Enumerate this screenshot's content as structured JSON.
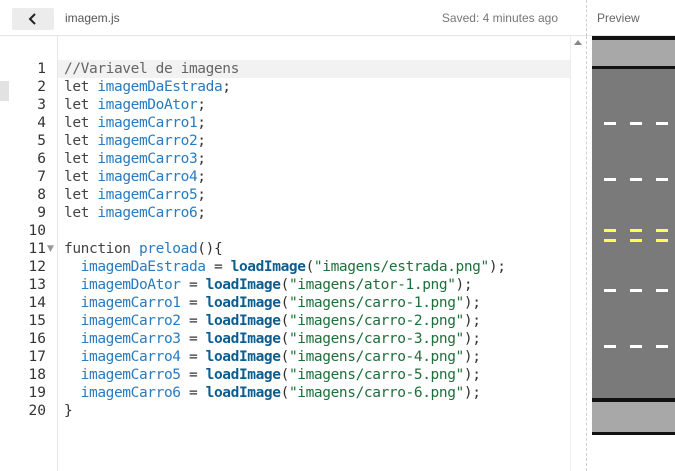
{
  "topbar": {
    "back_icon": "chevron-left-icon",
    "filename": "imagem.js",
    "saved_status": "Saved: 4 minutes ago",
    "preview_label": "Preview"
  },
  "editor": {
    "lines": [
      {
        "num": "1",
        "tokens": [
          {
            "t": "//Variavel de imagens",
            "c": "comment"
          }
        ]
      },
      {
        "num": "2",
        "tokens": [
          {
            "t": "let ",
            "c": "kw"
          },
          {
            "t": "imagemDaEstrada",
            "c": "var"
          },
          {
            "t": ";",
            "c": "punc"
          }
        ]
      },
      {
        "num": "3",
        "tokens": [
          {
            "t": "let ",
            "c": "kw"
          },
          {
            "t": "imagemDoAtor",
            "c": "var"
          },
          {
            "t": ";",
            "c": "punc"
          }
        ]
      },
      {
        "num": "4",
        "tokens": [
          {
            "t": "let ",
            "c": "kw"
          },
          {
            "t": "imagemCarro1",
            "c": "var"
          },
          {
            "t": ";",
            "c": "punc"
          }
        ]
      },
      {
        "num": "5",
        "tokens": [
          {
            "t": "let ",
            "c": "kw"
          },
          {
            "t": "imagemCarro2",
            "c": "var"
          },
          {
            "t": ";",
            "c": "punc"
          }
        ]
      },
      {
        "num": "6",
        "tokens": [
          {
            "t": "let ",
            "c": "kw"
          },
          {
            "t": "imagemCarro3",
            "c": "var"
          },
          {
            "t": ";",
            "c": "punc"
          }
        ]
      },
      {
        "num": "7",
        "tokens": [
          {
            "t": "let ",
            "c": "kw"
          },
          {
            "t": "imagemCarro4",
            "c": "var"
          },
          {
            "t": ";",
            "c": "punc"
          }
        ]
      },
      {
        "num": "8",
        "tokens": [
          {
            "t": "let ",
            "c": "kw"
          },
          {
            "t": "imagemCarro5",
            "c": "var"
          },
          {
            "t": ";",
            "c": "punc"
          }
        ]
      },
      {
        "num": "9",
        "tokens": [
          {
            "t": "let ",
            "c": "kw"
          },
          {
            "t": "imagemCarro6",
            "c": "var"
          },
          {
            "t": ";",
            "c": "punc"
          }
        ]
      },
      {
        "num": "10",
        "tokens": []
      },
      {
        "num": "11",
        "fold": true,
        "tokens": [
          {
            "t": "function ",
            "c": "kw"
          },
          {
            "t": "preload",
            "c": "var"
          },
          {
            "t": "(){",
            "c": "punc"
          }
        ]
      },
      {
        "num": "12",
        "tokens": [
          {
            "t": "  imagemDaEstrada",
            "c": "var"
          },
          {
            "t": " = ",
            "c": "punc"
          },
          {
            "t": "loadImage",
            "c": "fn"
          },
          {
            "t": "(",
            "c": "punc"
          },
          {
            "t": "\"imagens/estrada.png\"",
            "c": "str"
          },
          {
            "t": ");",
            "c": "punc"
          }
        ]
      },
      {
        "num": "13",
        "tokens": [
          {
            "t": "  imagemDoAtor",
            "c": "var"
          },
          {
            "t": " = ",
            "c": "punc"
          },
          {
            "t": "loadImage",
            "c": "fn"
          },
          {
            "t": "(",
            "c": "punc"
          },
          {
            "t": "\"imagens/ator-1.png\"",
            "c": "str"
          },
          {
            "t": ");",
            "c": "punc"
          }
        ]
      },
      {
        "num": "14",
        "tokens": [
          {
            "t": "  imagemCarro1",
            "c": "var"
          },
          {
            "t": " = ",
            "c": "punc"
          },
          {
            "t": "loadImage",
            "c": "fn"
          },
          {
            "t": "(",
            "c": "punc"
          },
          {
            "t": "\"imagens/carro-1.png\"",
            "c": "str"
          },
          {
            "t": ");",
            "c": "punc"
          }
        ]
      },
      {
        "num": "15",
        "tokens": [
          {
            "t": "  imagemCarro2",
            "c": "var"
          },
          {
            "t": " = ",
            "c": "punc"
          },
          {
            "t": "loadImage",
            "c": "fn"
          },
          {
            "t": "(",
            "c": "punc"
          },
          {
            "t": "\"imagens/carro-2.png\"",
            "c": "str"
          },
          {
            "t": ");",
            "c": "punc"
          }
        ]
      },
      {
        "num": "16",
        "tokens": [
          {
            "t": "  imagemCarro3",
            "c": "var"
          },
          {
            "t": " = ",
            "c": "punc"
          },
          {
            "t": "loadImage",
            "c": "fn"
          },
          {
            "t": "(",
            "c": "punc"
          },
          {
            "t": "\"imagens/carro-3.png\"",
            "c": "str"
          },
          {
            "t": ");",
            "c": "punc"
          }
        ]
      },
      {
        "num": "17",
        "tokens": [
          {
            "t": "  imagemCarro4",
            "c": "var"
          },
          {
            "t": " = ",
            "c": "punc"
          },
          {
            "t": "loadImage",
            "c": "fn"
          },
          {
            "t": "(",
            "c": "punc"
          },
          {
            "t": "\"imagens/carro-4.png\"",
            "c": "str"
          },
          {
            "t": ");",
            "c": "punc"
          }
        ]
      },
      {
        "num": "18",
        "tokens": [
          {
            "t": "  imagemCarro5",
            "c": "var"
          },
          {
            "t": " = ",
            "c": "punc"
          },
          {
            "t": "loadImage",
            "c": "fn"
          },
          {
            "t": "(",
            "c": "punc"
          },
          {
            "t": "\"imagens/carro-5.png\"",
            "c": "str"
          },
          {
            "t": ");",
            "c": "punc"
          }
        ]
      },
      {
        "num": "19",
        "tokens": [
          {
            "t": "  imagemCarro6",
            "c": "var"
          },
          {
            "t": " = ",
            "c": "punc"
          },
          {
            "t": "loadImage",
            "c": "fn"
          },
          {
            "t": "(",
            "c": "punc"
          },
          {
            "t": "\"imagens/carro-6.png\"",
            "c": "str"
          },
          {
            "t": ");",
            "c": "punc"
          }
        ]
      },
      {
        "num": "20",
        "tokens": [
          {
            "t": "}",
            "c": "punc"
          }
        ]
      }
    ]
  },
  "preview": {
    "road_color": "#7a7a7a",
    "sidewalk_color": "#a8a8a8",
    "edge_line_color": "#111111",
    "lane_dash_color": "#ffffff",
    "center_dash_color": "#ffff4d"
  }
}
